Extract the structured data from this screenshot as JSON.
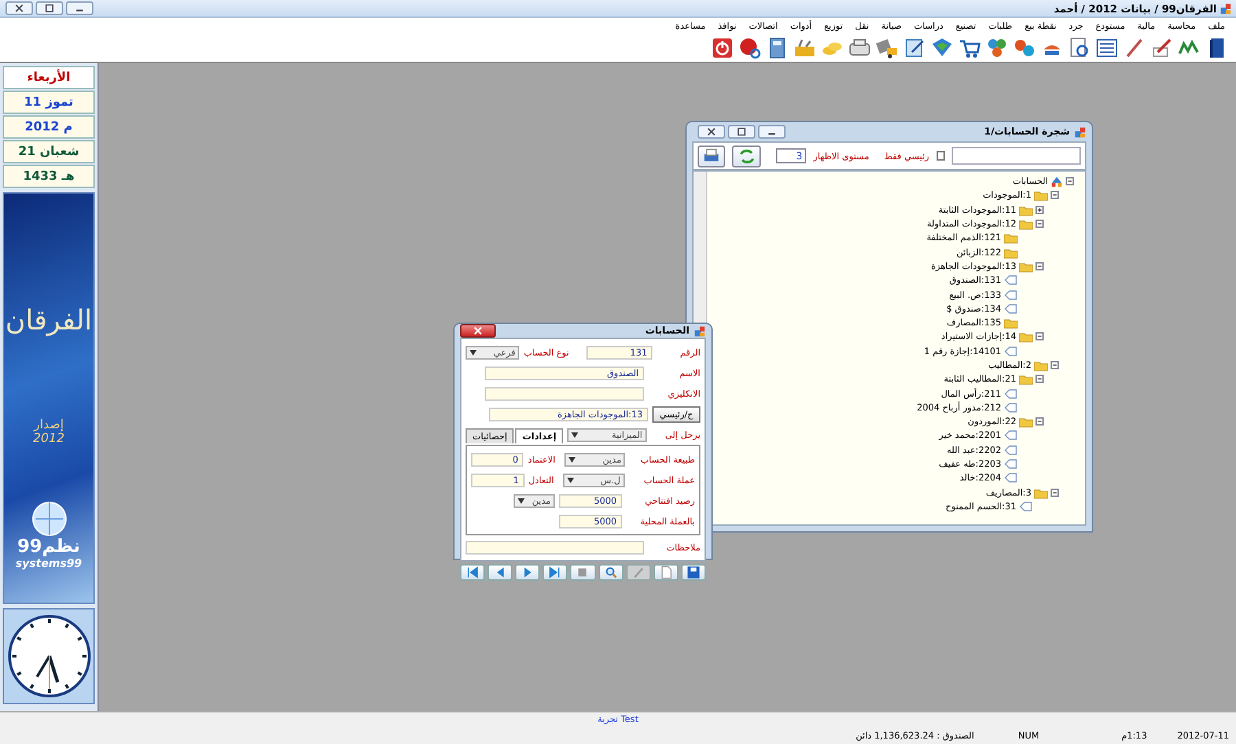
{
  "window": {
    "title": "الفرقان99 / بيانات 2012 / أحمد"
  },
  "menu": [
    "ملف",
    "محاسبة",
    "مالية",
    "مستودع",
    "جرد",
    "نقطة بيع",
    "طلبات",
    "تصنيع",
    "دراسات",
    "صيانة",
    "نقل",
    "توزيع",
    "أدوات",
    "اتصالات",
    "نوافذ",
    "مساعدة"
  ],
  "sidebar": {
    "dates": [
      {
        "text": "الأربعاء",
        "kind": "weekday"
      },
      {
        "text": "11 تموز",
        "kind": "gregorian"
      },
      {
        "text": "2012 م",
        "kind": "gregorian"
      },
      {
        "text": "21 شعبان",
        "kind": "hijri"
      },
      {
        "text": "1433 هـ",
        "kind": "hijri"
      }
    ],
    "banner": {
      "title": "الفرقان",
      "edition": "إصدار",
      "year": "2012",
      "brand_ar": "نظم99",
      "brand_en": "systems99"
    }
  },
  "tree_window": {
    "title": "شجرة الحسابات/1",
    "main_only": {
      "label": "رئيسي فقط",
      "checked": false
    },
    "level": {
      "label": "مستوى الاظهار",
      "value": "3"
    },
    "tree": [
      {
        "label": "الحسابات",
        "kind": "root",
        "expanded": true,
        "children": [
          {
            "label": "1:الموجودات",
            "kind": "folder",
            "expanded": true,
            "children": [
              {
                "label": "11:الموجودات الثابتة",
                "kind": "folder",
                "expanded": false
              },
              {
                "label": "12:الموجودات المتداولة",
                "kind": "folder",
                "expanded": true,
                "children": [
                  {
                    "label": "121:الذمم المختلفة",
                    "kind": "folder"
                  },
                  {
                    "label": "122:الزبائن",
                    "kind": "folder"
                  }
                ]
              },
              {
                "label": "13:الموجودات الجاهزة",
                "kind": "folder",
                "expanded": true,
                "children": [
                  {
                    "label": "131:الصندوق",
                    "kind": "leaf"
                  },
                  {
                    "label": "133:ص. البيع",
                    "kind": "leaf"
                  },
                  {
                    "label": "134:صندوق $",
                    "kind": "leaf"
                  },
                  {
                    "label": "135:المصارف",
                    "kind": "folder"
                  }
                ]
              },
              {
                "label": "14:إجازات الاستيراد",
                "kind": "folder",
                "expanded": true,
                "children": [
                  {
                    "label": "14101:إجازة رقم 1",
                    "kind": "leaf"
                  }
                ]
              }
            ]
          },
          {
            "label": "2:المطاليب",
            "kind": "folder",
            "expanded": true,
            "children": [
              {
                "label": "21:المطاليب الثابتة",
                "kind": "folder",
                "expanded": true,
                "children": [
                  {
                    "label": "211:رأس المال",
                    "kind": "leaf"
                  },
                  {
                    "label": "212:مدور أرباح 2004",
                    "kind": "leaf"
                  }
                ]
              },
              {
                "label": "22:الموردون",
                "kind": "folder",
                "expanded": true,
                "children": [
                  {
                    "label": "2201:محمد خير",
                    "kind": "leaf"
                  },
                  {
                    "label": "2202:عبد الله",
                    "kind": "leaf"
                  },
                  {
                    "label": "2203:طه عفيف",
                    "kind": "leaf"
                  },
                  {
                    "label": "2204:خالد",
                    "kind": "leaf"
                  }
                ]
              }
            ]
          },
          {
            "label": "3:المصاريف",
            "kind": "folder",
            "expanded": true,
            "children": [
              {
                "label": "31:الحسم الممنوح",
                "kind": "leaf"
              }
            ]
          }
        ]
      }
    ]
  },
  "account_dialog": {
    "title": "الحسابات",
    "number": {
      "label": "الرقم",
      "value": "131"
    },
    "type": {
      "label": "نوع الحساب",
      "value": "فرعي"
    },
    "name": {
      "label": "الاسم",
      "value": "الصندوق"
    },
    "english": {
      "label": "الانكليزي"
    },
    "parent": {
      "button": "ح/رئيسي",
      "value": "13:الموجودات الجاهزة"
    },
    "post_to": {
      "label": "يرحل إلى",
      "value": "الميزانية"
    },
    "tabs": [
      {
        "label": "إعدادات",
        "selected": true
      },
      {
        "label": "إحصائيات",
        "selected": false
      }
    ],
    "nature": {
      "label": "طبيعة الحساب",
      "value": "مدين"
    },
    "credit": {
      "label": "الاعتماد",
      "value": "0"
    },
    "currency": {
      "label": "عملة الحساب",
      "value": "ل.س"
    },
    "rate": {
      "label": "التعادل",
      "value": "1"
    },
    "opening": {
      "label": "رصيد افتتاحي",
      "value": "5000",
      "side": "مدين"
    },
    "local": {
      "label": "بالعملة المحلية",
      "value": "5000"
    },
    "notes": {
      "label": "ملاحظات"
    },
    "nav_buttons": [
      {
        "kind": "first",
        "disabled": false
      },
      {
        "kind": "prev",
        "disabled": false
      },
      {
        "kind": "next",
        "disabled": false
      },
      {
        "kind": "last",
        "disabled": false
      },
      {
        "kind": "delete",
        "disabled": false
      },
      {
        "kind": "search",
        "disabled": false
      },
      {
        "kind": "edit",
        "disabled": true
      },
      {
        "kind": "new",
        "disabled": false
      },
      {
        "kind": "save",
        "disabled": false
      }
    ]
  },
  "status_bar": {
    "mode": "تجربة Test",
    "date": "2012-07-11",
    "time": "1:13م",
    "num": "NUM",
    "balance": "الصندوق : 1,136,623.24 دائن"
  }
}
